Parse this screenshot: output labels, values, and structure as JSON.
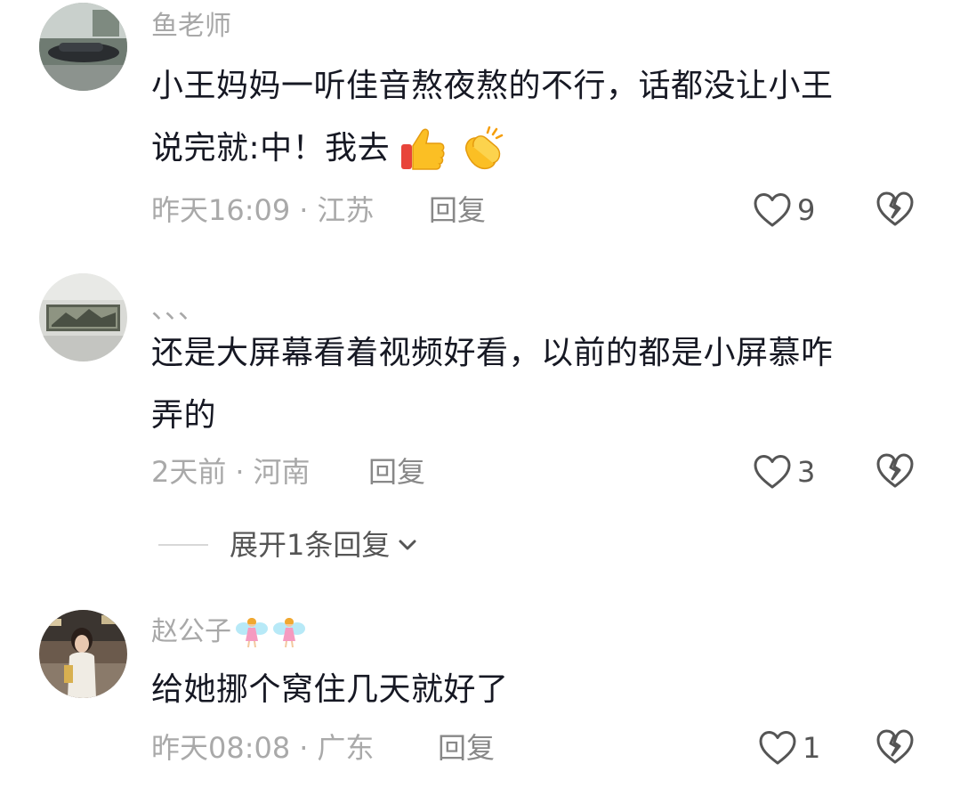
{
  "comments": [
    {
      "username": "鱼老师",
      "text_line1": "小王妈妈一听佳音熬夜熬的不行，话都没让小王",
      "text_line2": "说完就:中！我去",
      "emojis": [
        "thumbs-up-icon",
        "clapping-hands-icon"
      ],
      "time": "昨天16:09",
      "location": "江苏",
      "reply_label": "回复",
      "like_count": "9"
    },
    {
      "username": "、、、",
      "text_line1": "还是大屏幕看着视频好看，以前的都是小屏慕咋",
      "text_line2": "弄的",
      "time": "2天前",
      "location": "河南",
      "reply_label": "回复",
      "like_count": "3",
      "expand_label": "展开1条回复"
    },
    {
      "username": "赵公子",
      "username_badges": [
        "fairy-icon",
        "fairy-icon"
      ],
      "text_line1": "给她挪个窝住几天就好了",
      "time": "昨天08:08",
      "location": "广东",
      "reply_label": "回复",
      "like_count": "1"
    }
  ],
  "separator": "·",
  "colors": {
    "text": "#161823",
    "muted": "#a9a9a9",
    "icon": "#555555",
    "background": "#ffffff"
  }
}
